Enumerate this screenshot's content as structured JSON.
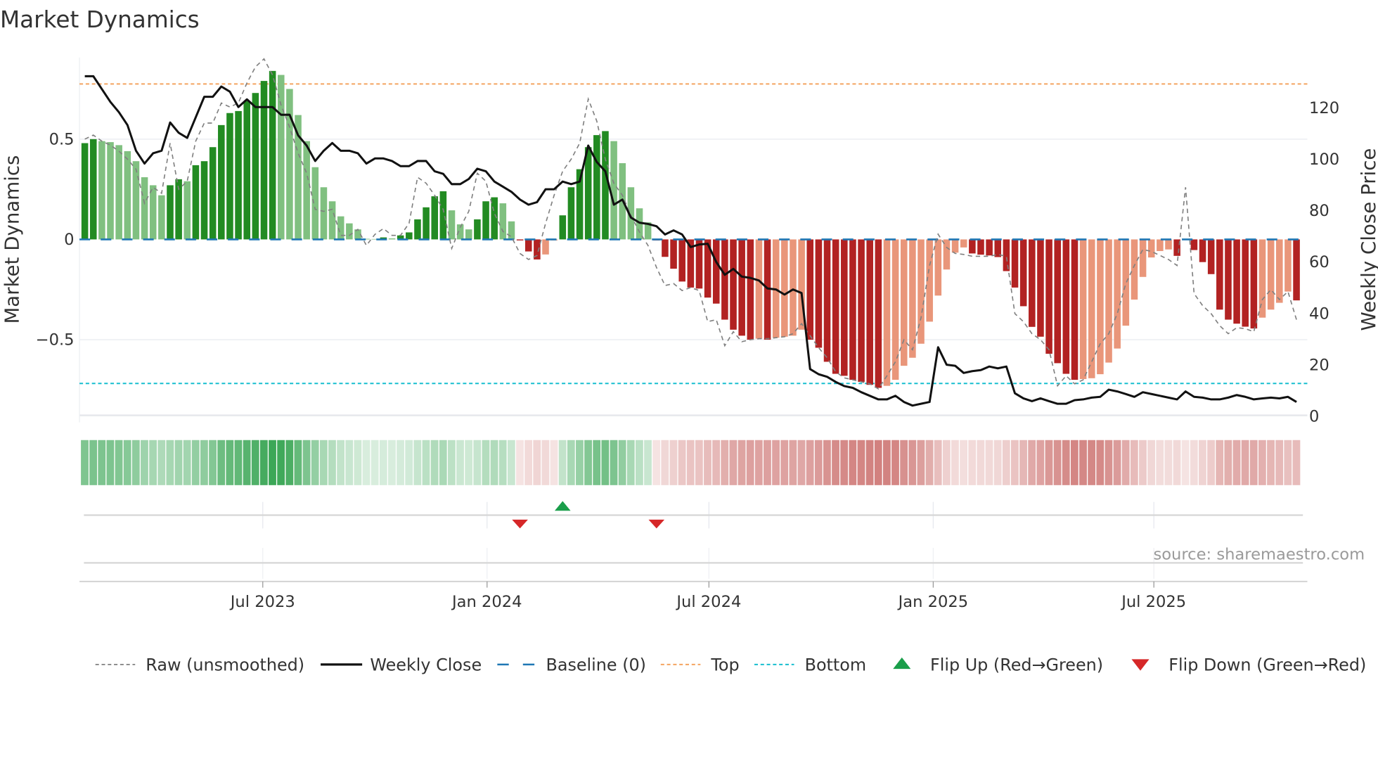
{
  "title": "Market Dynamics",
  "source": "source: sharemaestro.com",
  "colors": {
    "pos_dark": "#228b22",
    "pos_light": "#80c080",
    "neg_dark": "#b22222",
    "neg_light": "#e9967a",
    "raw": "#808080",
    "close": "#111111",
    "baseline": "#1f77b4",
    "top": "#f4a460",
    "bottom": "#17becf",
    "flip_up": "#1a9e4a",
    "flip_down": "#d62728",
    "strip_pos": "#3aa655",
    "strip_neg": "#c0504d"
  },
  "chart_data": {
    "type": "bar",
    "title": "Market Dynamics",
    "ylabel": "Market Dynamics",
    "y2label": "Weekly Close Price",
    "x_start": "2023-02-05",
    "x_step_days": 7,
    "ylim": [
      -0.877,
      0.907
    ],
    "y2lim": [
      0,
      139.3
    ],
    "y_ticks": [
      {
        "value": 0.5,
        "label": "0.5"
      },
      {
        "value": 0,
        "label": "0"
      },
      {
        "value": -0.5,
        "label": "−0.5"
      }
    ],
    "y2_ticks": [
      {
        "value": 0,
        "label": "0"
      },
      {
        "value": 20,
        "label": "20"
      },
      {
        "value": 40,
        "label": "40"
      },
      {
        "value": 60,
        "label": "60"
      },
      {
        "value": 80,
        "label": "80"
      },
      {
        "value": 100,
        "label": "100"
      },
      {
        "value": 120,
        "label": "120"
      }
    ],
    "x_ticks": [
      {
        "date": "2023-07-01",
        "label": "Jul 2023"
      },
      {
        "date": "2024-01-01",
        "label": "Jan 2024"
      },
      {
        "date": "2024-07-01",
        "label": "Jul 2024"
      },
      {
        "date": "2025-01-01",
        "label": "Jan 2025"
      },
      {
        "date": "2025-07-01",
        "label": "Jul 2025"
      }
    ],
    "baseline": 0,
    "top": 0.775,
    "bottom": -0.718,
    "grid": true,
    "legend_position": "bottom",
    "series": [
      {
        "name": "Market Dynamics",
        "axis": "left",
        "kind": "bar",
        "values": [
          0.48,
          0.5,
          0.49,
          0.485,
          0.47,
          0.44,
          0.39,
          0.31,
          0.27,
          0.22,
          0.27,
          0.3,
          0.29,
          0.37,
          0.39,
          0.46,
          0.57,
          0.63,
          0.64,
          0.69,
          0.73,
          0.79,
          0.84,
          0.82,
          0.75,
          0.62,
          0.49,
          0.36,
          0.26,
          0.19,
          0.115,
          0.08,
          0.05,
          0.003,
          0.002,
          0.01,
          0.005,
          0.02,
          0.035,
          0.1,
          0.16,
          0.215,
          0.24,
          0.145,
          0.075,
          0.05,
          0.1,
          0.19,
          0.21,
          0.18,
          0.09,
          -0.005,
          -0.06,
          -0.1,
          -0.075,
          -0.005,
          0.12,
          0.26,
          0.35,
          0.46,
          0.52,
          0.54,
          0.49,
          0.38,
          0.26,
          0.155,
          0.085,
          -0.005,
          -0.087,
          -0.146,
          -0.21,
          -0.24,
          -0.245,
          -0.29,
          -0.32,
          -0.4,
          -0.45,
          -0.48,
          -0.5,
          -0.495,
          -0.5,
          -0.49,
          -0.485,
          -0.48,
          -0.45,
          -0.5,
          -0.54,
          -0.61,
          -0.67,
          -0.68,
          -0.7,
          -0.71,
          -0.725,
          -0.74,
          -0.73,
          -0.7,
          -0.63,
          -0.59,
          -0.52,
          -0.41,
          -0.28,
          -0.15,
          -0.066,
          -0.04,
          -0.07,
          -0.076,
          -0.08,
          -0.088,
          -0.158,
          -0.24,
          -0.333,
          -0.436,
          -0.485,
          -0.57,
          -0.617,
          -0.67,
          -0.7,
          -0.696,
          -0.692,
          -0.672,
          -0.614,
          -0.544,
          -0.43,
          -0.3,
          -0.187,
          -0.09,
          -0.058,
          -0.05,
          -0.082,
          -0.003,
          -0.053,
          -0.113,
          -0.173,
          -0.35,
          -0.4,
          -0.42,
          -0.435,
          -0.444,
          -0.39,
          -0.35,
          -0.316,
          -0.26,
          -0.304
        ]
      },
      {
        "name": "Raw (unsmoothed)",
        "axis": "left",
        "kind": "line",
        "values": [
          0.5,
          0.52,
          0.49,
          0.47,
          0.44,
          0.4,
          0.35,
          0.18,
          0.26,
          0.23,
          0.48,
          0.25,
          0.29,
          0.49,
          0.58,
          0.58,
          0.68,
          0.66,
          0.68,
          0.78,
          0.86,
          0.9,
          0.82,
          0.67,
          0.56,
          0.43,
          0.33,
          0.15,
          0.14,
          0.15,
          0.02,
          0.02,
          0.05,
          -0.03,
          0.025,
          0.054,
          0.02,
          0.02,
          0.08,
          0.31,
          0.28,
          0.22,
          0.15,
          -0.045,
          0.06,
          0.14,
          0.33,
          0.29,
          0.13,
          0.04,
          0.013,
          -0.07,
          -0.1,
          -0.08,
          0.08,
          0.22,
          0.34,
          0.4,
          0.48,
          0.7,
          0.59,
          0.4,
          0.28,
          0.22,
          0.12,
          0.037,
          -0.03,
          -0.14,
          -0.23,
          -0.22,
          -0.255,
          -0.24,
          -0.255,
          -0.41,
          -0.4,
          -0.53,
          -0.46,
          -0.51,
          -0.5,
          -0.495,
          -0.495,
          -0.49,
          -0.485,
          -0.47,
          -0.42,
          -0.48,
          -0.54,
          -0.59,
          -0.66,
          -0.69,
          -0.7,
          -0.71,
          -0.72,
          -0.745,
          -0.68,
          -0.61,
          -0.5,
          -0.55,
          -0.39,
          -0.13,
          0.026,
          -0.04,
          -0.07,
          -0.075,
          -0.084,
          -0.084,
          -0.084,
          -0.075,
          -0.084,
          -0.37,
          -0.41,
          -0.47,
          -0.5,
          -0.55,
          -0.73,
          -0.68,
          -0.72,
          -0.7,
          -0.61,
          -0.52,
          -0.47,
          -0.37,
          -0.22,
          -0.13,
          -0.05,
          -0.06,
          -0.08,
          -0.1,
          -0.13,
          0.26,
          -0.27,
          -0.33,
          -0.37,
          -0.43,
          -0.47,
          -0.44,
          -0.445,
          -0.46,
          -0.3,
          -0.25,
          -0.3,
          -0.26,
          -0.4
        ]
      },
      {
        "name": "Weekly Close",
        "axis": "right",
        "kind": "line",
        "values": [
          132,
          132,
          127,
          122,
          118,
          113,
          103,
          98,
          102,
          103,
          114,
          110,
          108,
          116,
          124,
          124,
          128,
          126,
          120,
          123,
          120,
          120,
          120,
          117,
          117,
          109,
          105,
          99,
          103,
          106,
          103,
          103,
          102,
          98,
          100,
          100,
          99,
          97,
          97,
          99,
          99,
          95,
          94,
          90,
          90,
          92,
          96,
          95,
          91,
          89,
          87,
          84,
          82,
          83,
          88,
          88,
          91,
          90,
          91,
          105,
          98.6,
          95,
          82,
          84,
          77,
          75,
          74.5,
          73.6,
          70.4,
          72,
          70.4,
          65.5,
          66.5,
          66.8,
          59.7,
          54.7,
          57,
          54,
          53.5,
          52.5,
          49.4,
          49,
          47,
          49,
          47.6,
          18,
          16,
          15,
          13,
          11.4,
          10.7,
          9,
          7.6,
          6.2,
          6.2,
          7.6,
          5.2,
          3.8,
          4.5,
          5.2,
          26.5,
          19.7,
          19.3,
          16.5,
          17.2,
          17.6,
          19,
          18.3,
          19,
          8.6,
          6.6,
          5.5,
          6.6,
          5.5,
          4.5,
          4.5,
          5.9,
          6.2,
          6.9,
          7.2,
          10,
          9.3,
          8.3,
          7.2,
          9,
          8.3,
          7.6,
          6.9,
          6.2,
          9.3,
          7.2,
          6.9,
          6.2,
          6.2,
          6.9,
          7.9,
          7.2,
          6.2,
          6.6,
          6.9,
          6.6,
          7.2,
          5.2
        ]
      }
    ],
    "flips": [
      {
        "date": "2024-01-28",
        "type": "down"
      },
      {
        "date": "2024-03-03",
        "type": "up"
      },
      {
        "date": "2024-05-19",
        "type": "down"
      }
    ],
    "legend": [
      {
        "label": "Raw (unsmoothed)",
        "style": "raw"
      },
      {
        "label": "Weekly Close",
        "style": "close"
      },
      {
        "label": "Baseline (0)",
        "style": "baseline"
      },
      {
        "label": "Top",
        "style": "top"
      },
      {
        "label": "Bottom",
        "style": "bottom"
      },
      {
        "label": "Flip Up (Red→Green)",
        "style": "flip_up"
      },
      {
        "label": "Flip Down (Green→Red)",
        "style": "flip_down"
      }
    ]
  }
}
